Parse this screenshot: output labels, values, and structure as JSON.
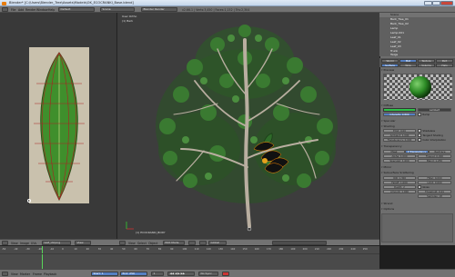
{
  "window": {
    "title": "Blender* [C:\\Users\\Blender_Tree\\Assets\\Models\\OK_ECOCRANKI_Base.blend]"
  },
  "main_header": {
    "menus": [
      "File",
      "Add",
      "Render",
      "Window",
      "Help"
    ],
    "layout": "Default",
    "scene": "Scene",
    "engine": "Blender Render",
    "stats": "v2.66.1 | Verts:3,450 | Faces:1,152 | Tris:2,304"
  },
  "viewport": {
    "view_label": "User Ortho",
    "object_label": "(1) Bark",
    "selection_label": "(1) ECOCRANKI_BODY"
  },
  "image_editor_header": {
    "menus": [
      "View",
      "Image",
      "UVs"
    ],
    "image_name": "leaf_UV.png",
    "mode": "View"
  },
  "viewport_header": {
    "menus": [
      "View",
      "Select",
      "Object"
    ],
    "mode": "Edit Mode",
    "pivot": "Global"
  },
  "outliner": {
    "rows": [
      "Scene",
      "Bark_Tree_01",
      "Bark_Tree_02",
      "Lamp",
      "Lamp.001",
      "Leaf_01",
      "Leaf_02",
      "Leaf_03",
      "Trunk",
      "Twigs"
    ]
  },
  "properties": {
    "tabs_row1": [
      "World",
      "Mat",
      "Texture",
      "Part"
    ],
    "tabs_row2": [
      "Surface",
      "Wire",
      "Volume",
      "Halo"
    ],
    "sections": {
      "preview": "Preview",
      "diffuse": "Diffuse",
      "specular": "Specular",
      "shading": "Shading",
      "transparency": "Transparency",
      "mirror": "Mirror",
      "sss": "Subsurface Scattering",
      "strand": "Strand",
      "options": "Options"
    },
    "diffuse": {
      "shader": "Lambert",
      "intensity": "Intensity: 0.800",
      "ramp": "Ramp",
      "color": "#2ec24a"
    },
    "shading": {
      "emit": "Emit: 0.00",
      "ambient": "Ambient: 1.000",
      "translucency": "Translucency: 0.000",
      "shadeless": "Shadeless",
      "tangent": "Tangent Shading",
      "cubic": "Cubic Interpolation"
    },
    "transparency_modes": [
      "Mask",
      "Z Transparency",
      "Raytrace"
    ],
    "transparency_fields": {
      "alpha": "Alpha: 1.000",
      "fresnel": "Fresnel: 0.000",
      "specular": "Specular: 1.000",
      "blend": "Blend: 1.250"
    },
    "bottom_fields": {
      "ior": "IOR: 1.300",
      "filter": "Filter: 0.000",
      "falloff": "Falloff: 1.000",
      "limit": "Limit: 0.000",
      "depth": "Depth: 2",
      "gloss": "Gloss",
      "amount": "Amount: 1.000",
      "threshold": "Threshold: 0.01",
      "samples": "Samples: 18"
    }
  },
  "timeline": {
    "ticks": [
      "-50",
      "-40",
      "-30",
      "-20",
      "-10",
      "0",
      "10",
      "20",
      "30",
      "40",
      "50",
      "60",
      "70",
      "80",
      "90",
      "100",
      "110",
      "120",
      "130",
      "140",
      "150",
      "160",
      "170",
      "180",
      "190",
      "200",
      "210",
      "220",
      "230",
      "240",
      "250"
    ],
    "menus": [
      "View",
      "Marker",
      "Frame",
      "Playback"
    ],
    "start": "Start: 1",
    "end": "End: 250",
    "current": "1",
    "sync": "No Sync"
  }
}
